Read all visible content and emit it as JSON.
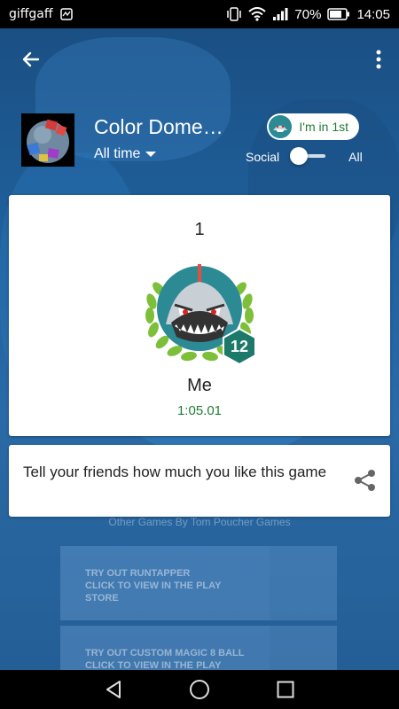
{
  "status_bar": {
    "carrier": "giffgaff",
    "battery": "70%",
    "time": "14:05"
  },
  "toolbar": {
    "back_icon": "arrow-left-icon",
    "menu_icon": "more-vert-icon"
  },
  "header": {
    "game_title": "Color Dome…",
    "time_filter": "All time",
    "rank_pill": "I'm in 1st",
    "toggle_left": "Social",
    "toggle_right": "All"
  },
  "leaderboard": {
    "rank": "1",
    "player_name": "Me",
    "score": "1:05.01",
    "level": "12"
  },
  "share": {
    "text": "Tell your friends how much you like this game",
    "icon": "share-icon"
  },
  "background": {
    "section_title": "Other Games By Tom Poucher Games",
    "promos": [
      {
        "line1": "TRY OUT RUNTAPPER",
        "line2": "CLICK TO VIEW IN THE PLAY STORE"
      },
      {
        "line1": "TRY OUT CUSTOM MAGIC 8 BALL",
        "line2": "CLICK TO VIEW IN THE PLAY STORE"
      }
    ]
  },
  "colors": {
    "accent_green": "#1f7d34",
    "background_blue": "#1d5a92",
    "badge_teal": "#2c8a95"
  }
}
